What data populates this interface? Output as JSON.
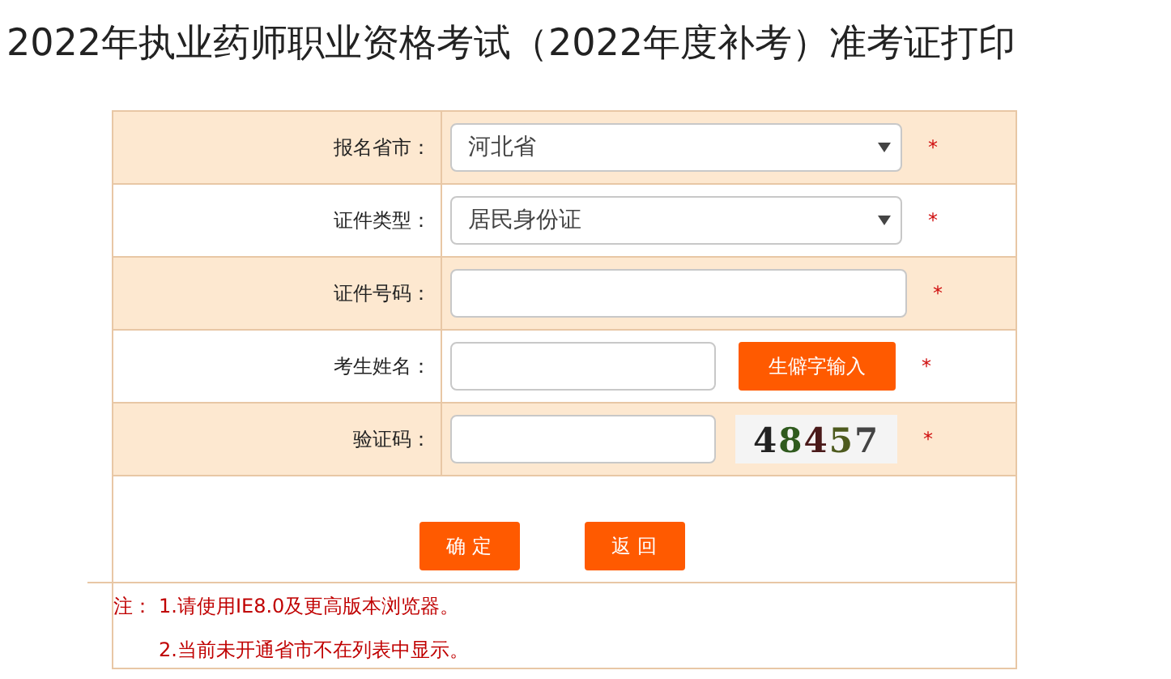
{
  "title": "2022年执业药师职业资格考试（2022年度补考）准考证打印",
  "form": {
    "rows": [
      {
        "kind": "select",
        "label": "报名省市：",
        "value": "河北省",
        "required": "*"
      },
      {
        "kind": "select",
        "label": "证件类型：",
        "value": "居民身份证",
        "required": "*"
      },
      {
        "kind": "input",
        "label": "证件号码：",
        "required": "*"
      },
      {
        "kind": "input_button",
        "label": "考生姓名：",
        "button": "生僻字输入",
        "required": "*"
      },
      {
        "kind": "captcha",
        "label": "验证码：",
        "captcha": "48457",
        "required": "*"
      }
    ],
    "buttons": [
      "确 定",
      "返 回"
    ],
    "notes": {
      "label": "注：",
      "items": [
        "1.请使用IE8.0及更高版本浏览器。",
        "2.当前未开通省市不在列表中显示。"
      ]
    }
  }
}
